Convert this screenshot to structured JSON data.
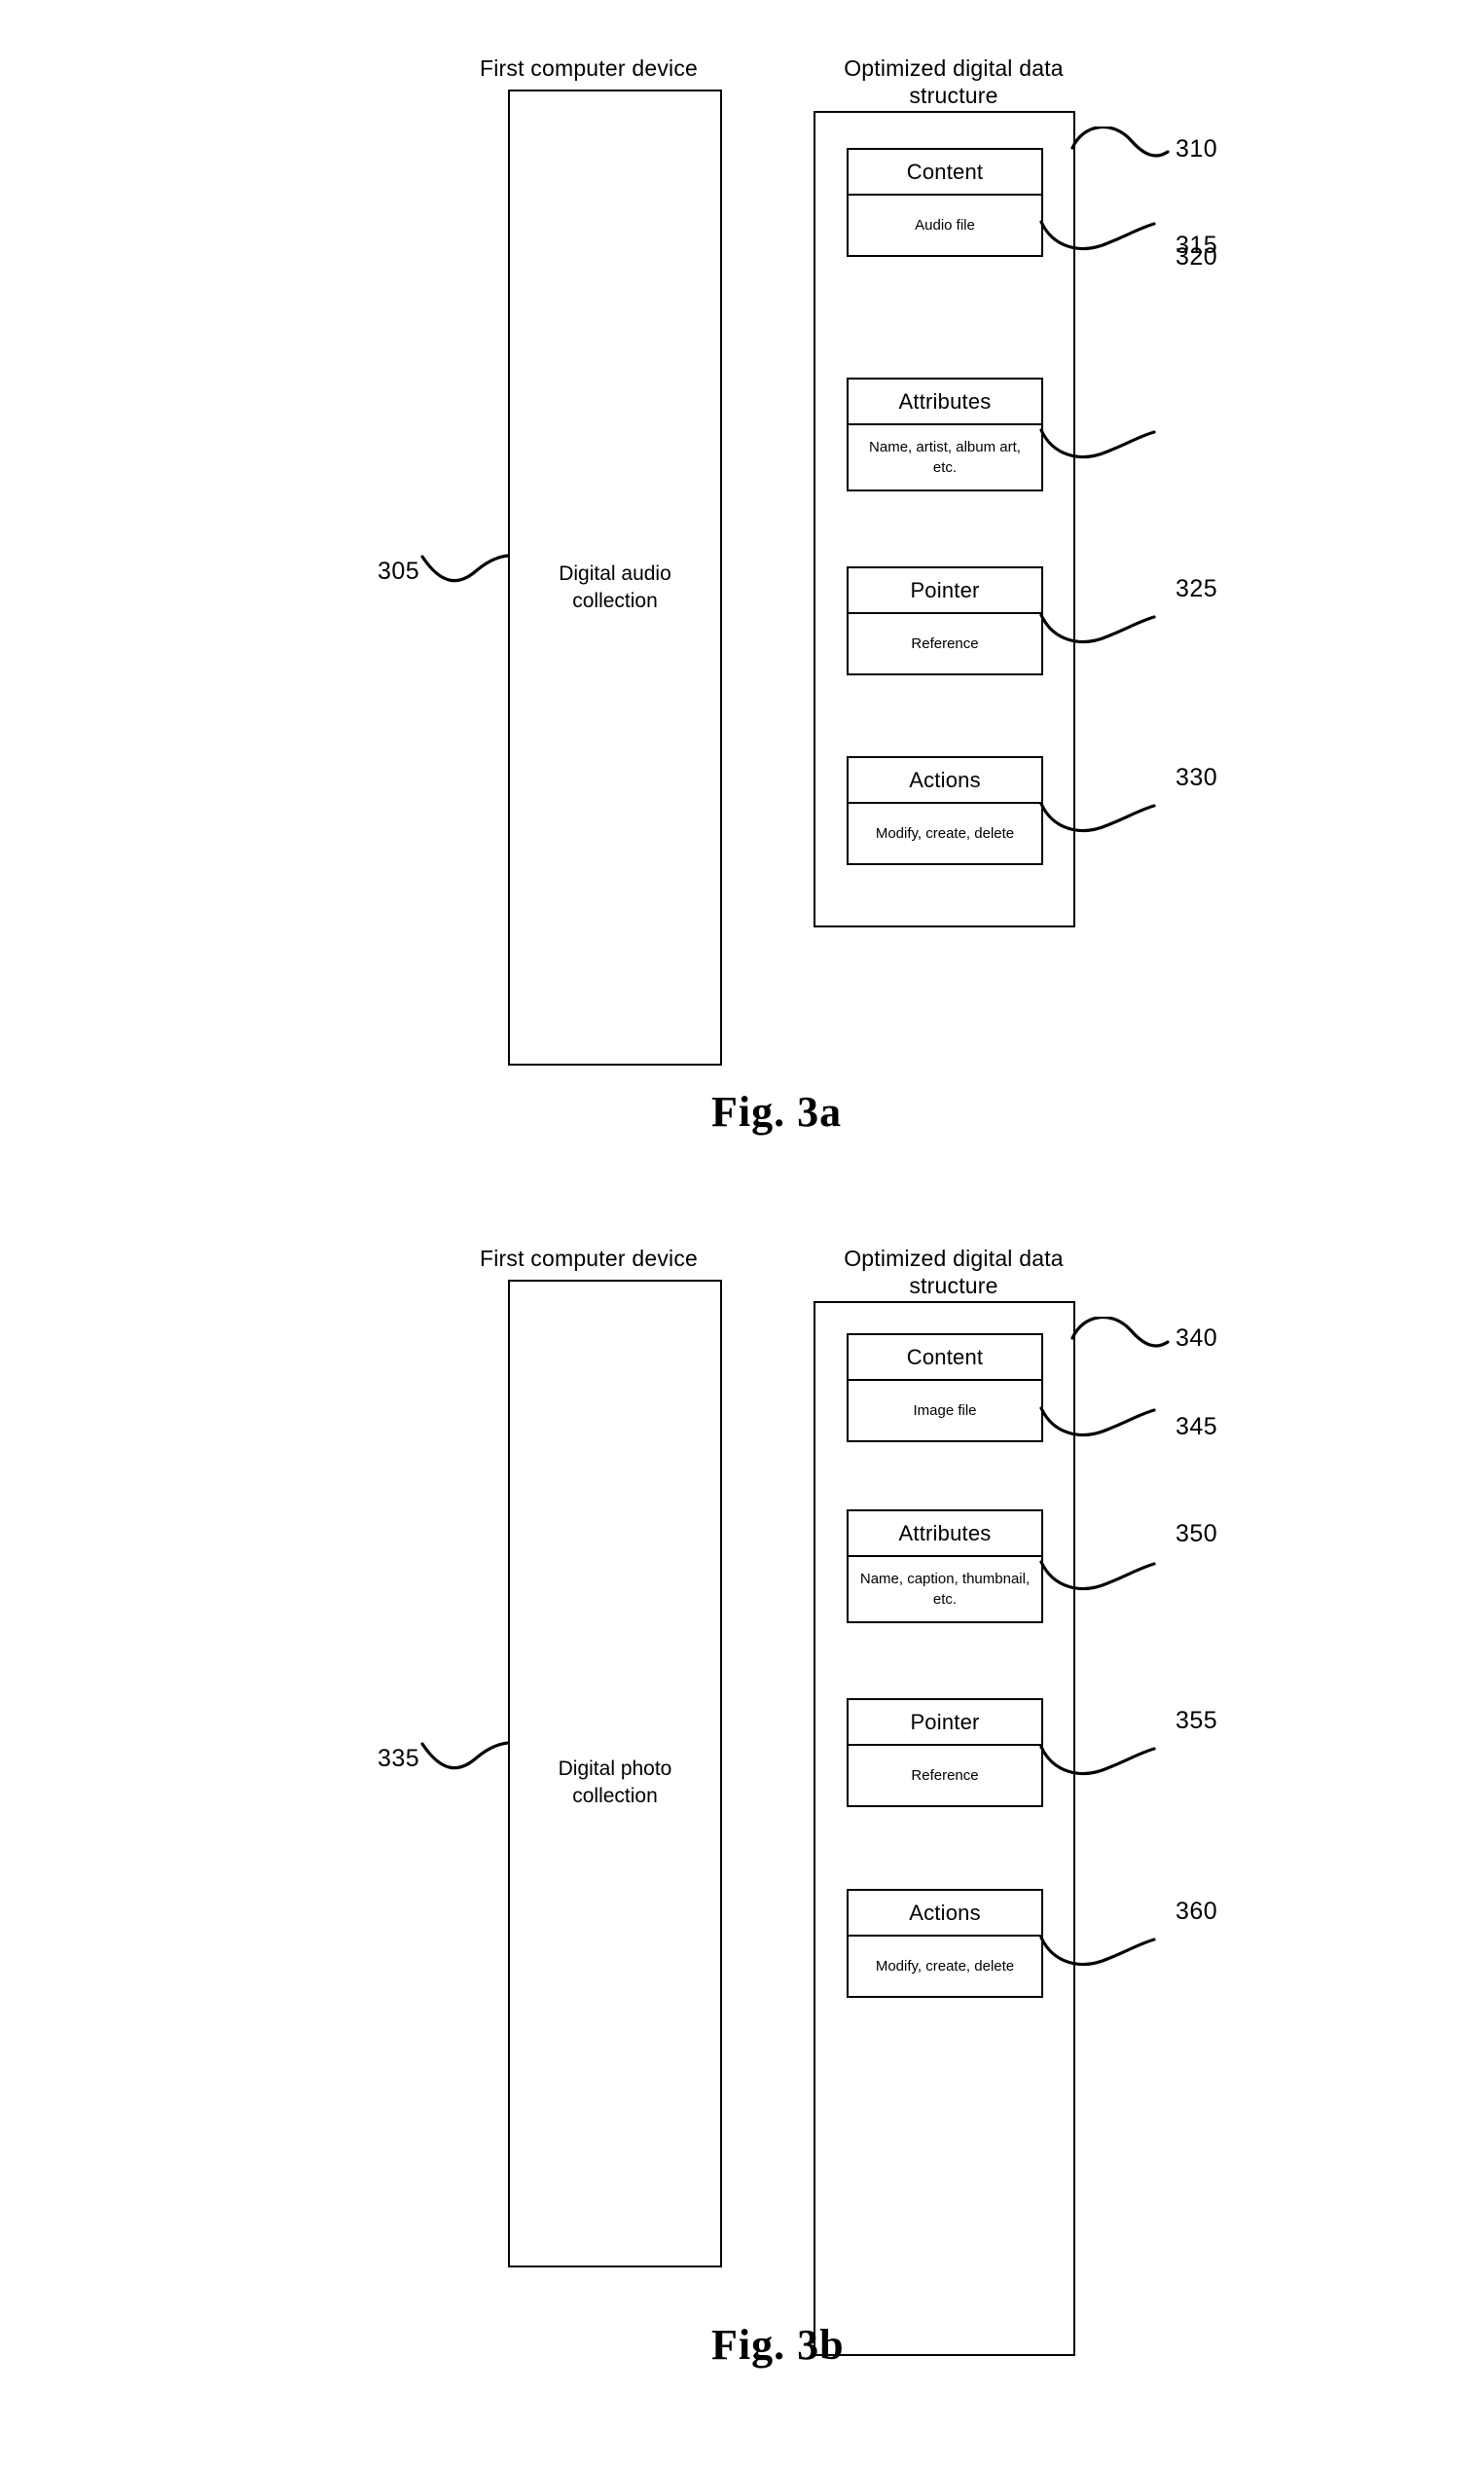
{
  "figures": [
    {
      "id": "fig-3a",
      "caption": "Fig. 3a",
      "device": {
        "header": "First computer device",
        "label_line1": "Digital audio",
        "label_line2": "collection",
        "ref": "305"
      },
      "structure": {
        "header_line1": "Optimized digital data",
        "header_line2": "structure",
        "ref": "310",
        "fields": [
          {
            "title": "Content",
            "value": "Audio file",
            "ref": "315"
          },
          {
            "title": "Attributes",
            "value": "Name, artist, album art, etc.",
            "ref": "320"
          },
          {
            "title": "Pointer",
            "value": "Reference",
            "ref": "325"
          },
          {
            "title": "Actions",
            "value": "Modify, create, delete",
            "ref": "330"
          }
        ]
      }
    },
    {
      "id": "fig-3b",
      "caption": "Fig. 3b",
      "device": {
        "header": "First computer device",
        "label_line1": "Digital photo",
        "label_line2": "collection",
        "ref": "335"
      },
      "structure": {
        "header_line1": "Optimized digital data",
        "header_line2": "structure",
        "ref": "340",
        "fields": [
          {
            "title": "Content",
            "value": "Image file",
            "ref": "345"
          },
          {
            "title": "Attributes",
            "value": "Name, caption, thumbnail, etc.",
            "ref": "350"
          },
          {
            "title": "Pointer",
            "value": "Reference",
            "ref": "355"
          },
          {
            "title": "Actions",
            "value": "Modify, create, delete",
            "ref": "360"
          }
        ]
      }
    }
  ],
  "colors": {
    "ink": "#000000",
    "paper": "#ffffff"
  }
}
